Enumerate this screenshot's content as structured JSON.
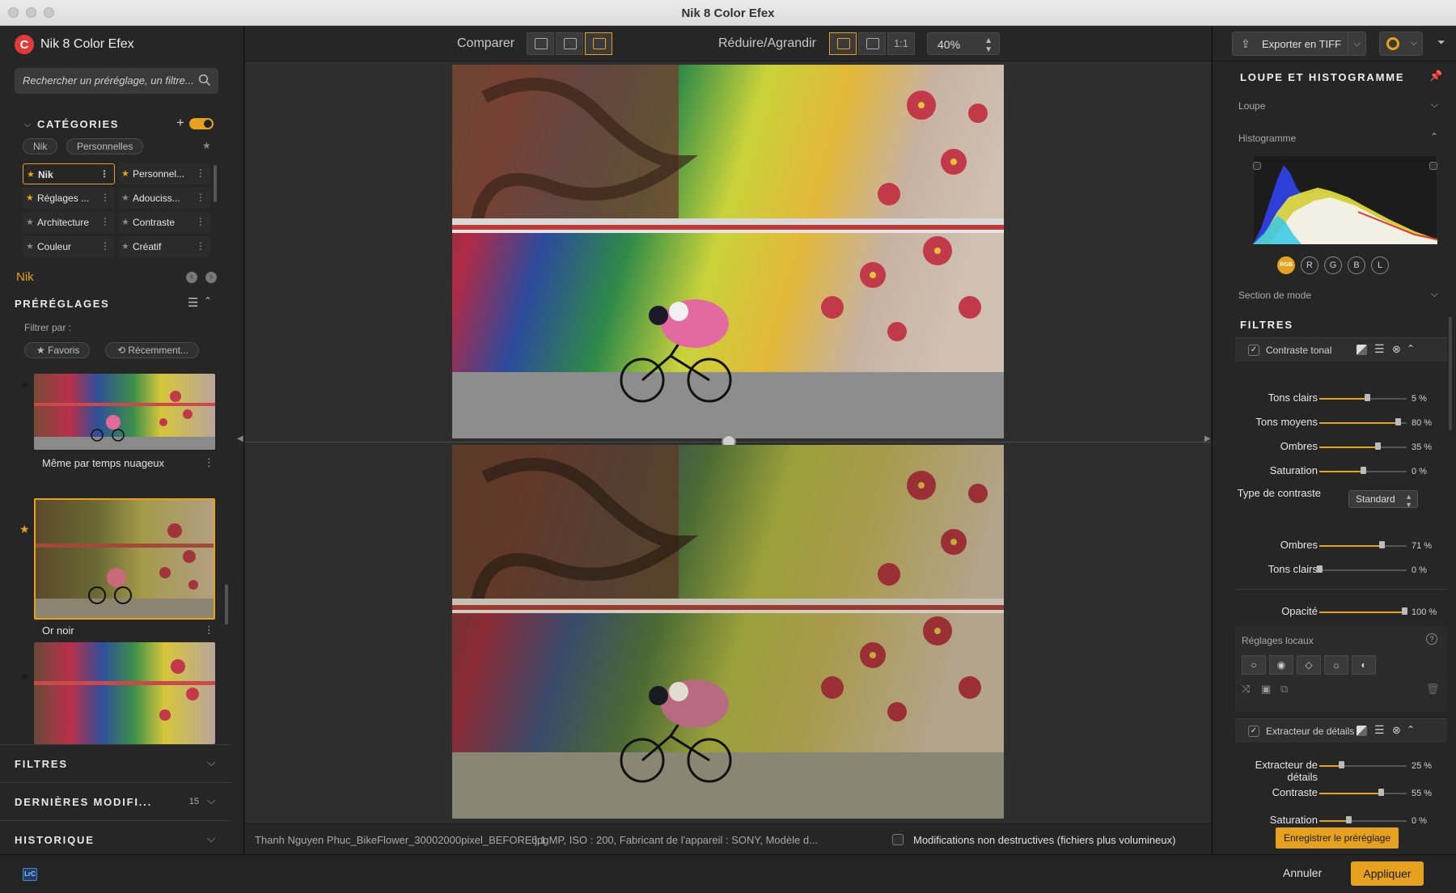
{
  "window": {
    "title": "Nik 8 Color Efex"
  },
  "left": {
    "brand": "Nik 8 Color Efex",
    "search_placeholder": "Rechercher un préréglage, un filtre...",
    "categories_title": "CATÉGORIES",
    "category_pills": [
      "Nik",
      "Personnelles"
    ],
    "categories": [
      {
        "label": "Nik",
        "starred": true,
        "selected": true
      },
      {
        "label": "Personnel...",
        "starred": true,
        "selected": false
      },
      {
        "label": "Réglages ...",
        "starred": true,
        "selected": false
      },
      {
        "label": "Adouciss...",
        "starred": false,
        "selected": false
      },
      {
        "label": "Architecture",
        "starred": false,
        "selected": false
      },
      {
        "label": "Contraste",
        "starred": false,
        "selected": false
      },
      {
        "label": "Couleur",
        "starred": false,
        "selected": false
      },
      {
        "label": "Créatif",
        "starred": false,
        "selected": false
      }
    ],
    "current_category": "Nik",
    "presets_title": "PRÉRÉGLAGES",
    "filter_by": "Filtrer par :",
    "filter_pills": [
      "Favoris",
      "Récemment..."
    ],
    "presets": [
      {
        "caption": "Même par temps nuageux"
      },
      {
        "caption": "Or noir"
      }
    ],
    "sections": [
      {
        "label": "FILTRES",
        "count": ""
      },
      {
        "label": "DERNIÈRES MODIFI...",
        "count": "15"
      },
      {
        "label": "HISTORIQUE",
        "count": ""
      }
    ]
  },
  "toolbar": {
    "compare_label": "Comparer",
    "resize_label": "Réduire/Agrandir",
    "one_to_one": "1:1",
    "zoom": "40%"
  },
  "status": {
    "filename": "Thanh Nguyen Phuc_BikeFlower_30002000pixel_BEFORE.jpg",
    "meta": "6.1 MP, ISO : 200, Fabricant de l'appareil : SONY, Modèle d...",
    "nondestructive": "Modifications non destructives (fichiers plus volumineux)"
  },
  "right": {
    "export_label": "Exporter en TIFF",
    "loupe_section": "LOUPE ET HISTOGRAMME",
    "loupe": "Loupe",
    "histogram": "Histogramme",
    "channels": [
      "RGB",
      "R",
      "G",
      "B",
      "L"
    ],
    "mode_section": "Section de mode",
    "filters_title": "FILTRES",
    "filter1": {
      "name": "Contraste tonal",
      "sliders": [
        {
          "label": "Tons clairs",
          "value": "5 %",
          "level": 0.55
        },
        {
          "label": "Tons moyens",
          "value": "80 %",
          "level": 0.9
        },
        {
          "label": "Ombres",
          "value": "35 %",
          "level": 0.67
        },
        {
          "label": "Saturation",
          "value": "0 %",
          "level": 0.5
        }
      ],
      "contrast_type_label": "Type de contraste",
      "contrast_type_value": "Standard",
      "sliders2": [
        {
          "label": "Ombres",
          "value": "71 %",
          "level": 0.71
        },
        {
          "label": "Tons clairs",
          "value": "0 %",
          "level": 0.0
        }
      ],
      "opacity_label": "Opacité",
      "opacity_value": "100 %",
      "opacity_level": 1.0,
      "local_label": "Réglages locaux"
    },
    "filter2": {
      "name": "Extracteur de détails",
      "sliders": [
        {
          "label": "Extracteur de détails",
          "value": "25 %",
          "level": 0.25
        },
        {
          "label": "Contraste",
          "value": "55 %",
          "level": 0.7
        },
        {
          "label": "Saturation",
          "value": "0 %",
          "level": 0.33
        }
      ]
    },
    "save_preset": "Enregistrer le préréglage"
  },
  "bottom": {
    "lrc": "LrC",
    "cancel": "Annuler",
    "apply": "Appliquer"
  },
  "colors": {
    "accent": "#e6a21c",
    "panel": "#262626",
    "canvas": "#2e2e2e"
  }
}
